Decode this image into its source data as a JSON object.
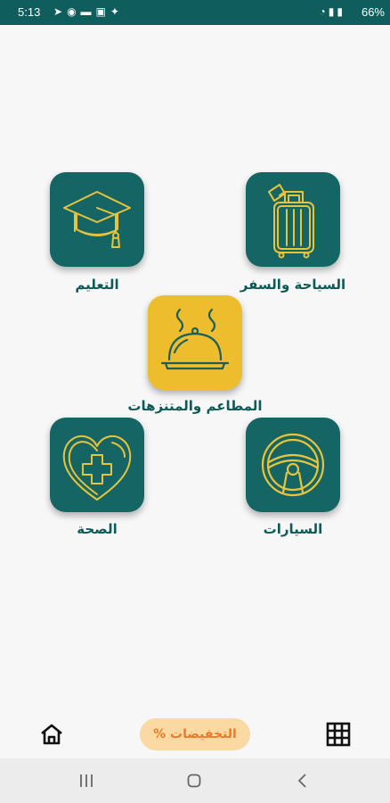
{
  "status_bar": {
    "time": "5:13",
    "battery": "66%",
    "left_icons": [
      "telegram-icon",
      "messenger-icon",
      "notification-icon",
      "gallery-icon",
      "twitter-icon"
    ],
    "right_icons": [
      "wifi-icon",
      "signal-icon",
      "signal-icon"
    ]
  },
  "categories": {
    "education": {
      "label": "التعليم",
      "icon": "graduation-cap-icon",
      "color": "#146563"
    },
    "travel": {
      "label": "السياحة والسفر",
      "icon": "luggage-icon",
      "color": "#146563"
    },
    "restaurants": {
      "label": "المطاعم والمتنزهات",
      "icon": "food-cloche-icon",
      "color": "#eebd2e"
    },
    "health": {
      "label": "الصحة",
      "icon": "heart-medical-icon",
      "color": "#146563"
    },
    "cars": {
      "label": "السيارات",
      "icon": "steering-wheel-icon",
      "color": "#146563"
    }
  },
  "bottom_nav": {
    "home_icon": "home-icon",
    "discounts_label": "التخفيضات %",
    "grid_icon": "grid-icon"
  },
  "colors": {
    "primary": "#146563",
    "accent": "#eebd2e",
    "icon_stroke": "#e8c33c",
    "discount_bg": "#fbd9a3",
    "discount_text": "#ea7a26"
  }
}
